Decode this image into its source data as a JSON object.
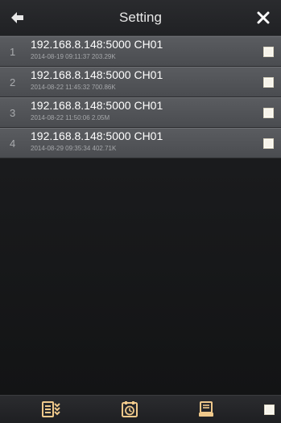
{
  "header": {
    "title": "Setting",
    "back_icon": "arrow-left-icon",
    "close_icon": "close-icon"
  },
  "recordings": [
    {
      "index": "1",
      "address": "192.168.8.148:5000 CH01",
      "details": "2014-08-19 09:11:37 203.29K"
    },
    {
      "index": "2",
      "address": "192.168.8.148:5000 CH01",
      "details": "2014-08-22 11:45:32 700.86K"
    },
    {
      "index": "3",
      "address": "192.168.8.148:5000 CH01",
      "details": "2014-08-22 11:50:06 2.05M"
    },
    {
      "index": "4",
      "address": "192.168.8.148:5000 CH01",
      "details": "2014-08-29 09:35:34 402.71K"
    }
  ],
  "footer": {
    "icons": [
      "list-sort-icon",
      "timer-icon",
      "storage-icon"
    ]
  },
  "colors": {
    "accent": "#f0c98b",
    "row_bg": "#4f5155",
    "header_bg": "#232427"
  }
}
